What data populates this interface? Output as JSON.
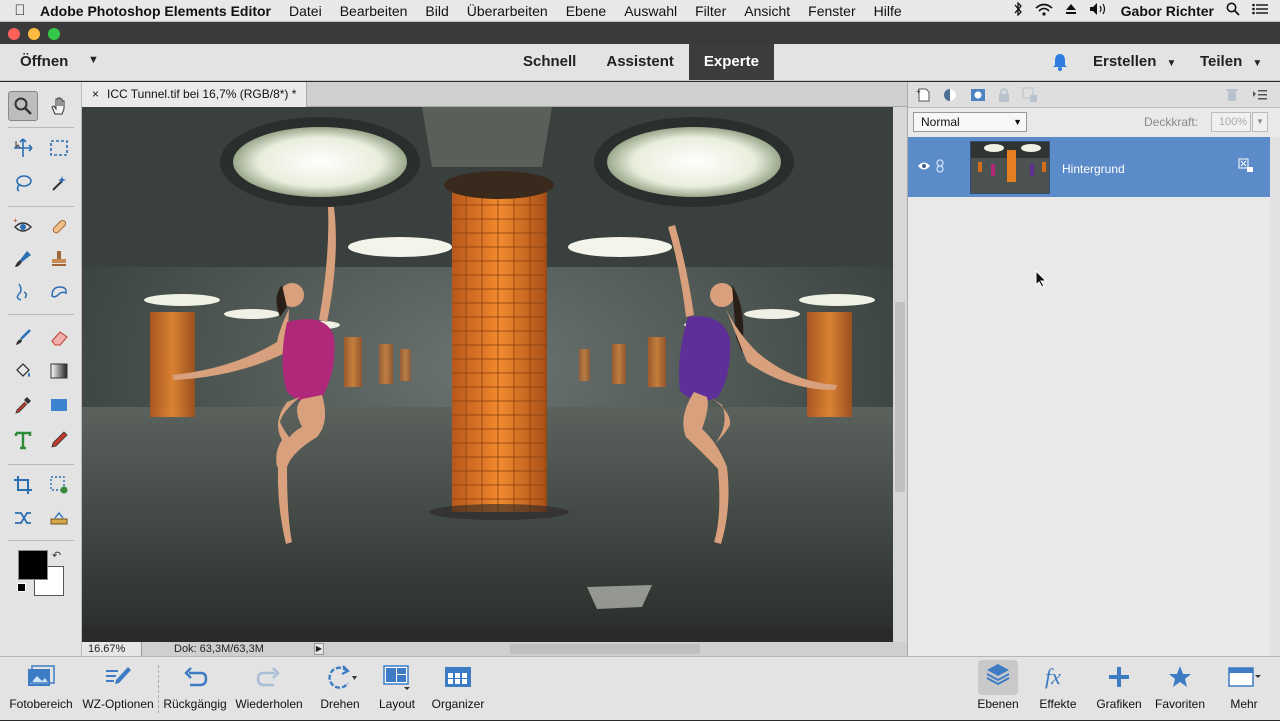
{
  "menubar": {
    "apple": "",
    "app_name": "Adobe Photoshop Elements Editor",
    "menus": [
      "Datei",
      "Bearbeiten",
      "Bild",
      "Überarbeiten",
      "Ebene",
      "Auswahl",
      "Filter",
      "Ansicht",
      "Fenster",
      "Hilfe"
    ],
    "user": "Gabor Richter"
  },
  "topbar": {
    "open_label": "Öffnen",
    "modes": [
      "Schnell",
      "Assistent",
      "Experte"
    ],
    "active_mode": "Experte",
    "create_label": "Erstellen",
    "share_label": "Teilen"
  },
  "document": {
    "tab_title": "ICC Tunnel.tif bei 16,7% (RGB/8*) *",
    "close_glyph": "×"
  },
  "status": {
    "zoom": "16.67%",
    "doc_size": "Dok: 63,3M/63,3M"
  },
  "layers_panel": {
    "blend_mode": "Normal",
    "opacity_label": "Deckkraft:",
    "opacity_value": "100%",
    "layers": [
      {
        "name": "Hintergrund",
        "visible": true,
        "locked": true,
        "selected": true
      }
    ]
  },
  "taskbar": {
    "left": [
      {
        "label": "Fotobereich",
        "icon": "photo-bin-icon"
      },
      {
        "label": "WZ-Optionen",
        "icon": "tool-options-icon"
      },
      {
        "label": "Rückgängig",
        "icon": "undo-icon"
      },
      {
        "label": "Wiederholen",
        "icon": "redo-icon"
      },
      {
        "label": "Drehen",
        "icon": "rotate-icon"
      },
      {
        "label": "Layout",
        "icon": "layout-icon"
      },
      {
        "label": "Organizer",
        "icon": "organizer-icon"
      }
    ],
    "right": [
      {
        "label": "Ebenen",
        "icon": "layers-icon"
      },
      {
        "label": "Effekte",
        "icon": "fx-icon"
      },
      {
        "label": "Grafiken",
        "icon": "plus-icon"
      },
      {
        "label": "Favoriten",
        "icon": "star-icon"
      },
      {
        "label": "Mehr",
        "icon": "more-panels-icon"
      }
    ]
  },
  "colors": {
    "accent": "#5b8bc9",
    "mode_active_bg": "#3c3c3c",
    "pillar_orange": "#e67e22"
  }
}
